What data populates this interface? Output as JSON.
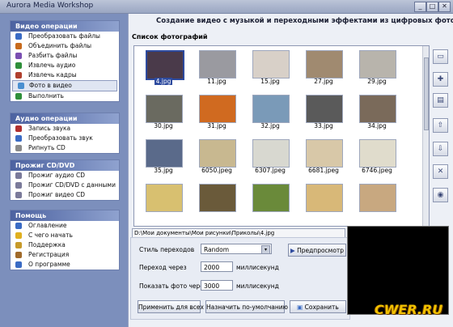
{
  "window": {
    "title": "Aurora Media Workshop",
    "controls": [
      "_",
      "□",
      "✕"
    ]
  },
  "sidebar": {
    "groups": [
      {
        "title": "Видео операции",
        "items": [
          {
            "label": "Преобразовать файлы",
            "icon": "film-icon",
            "color": "#3a6bc4"
          },
          {
            "label": "Объединить файлы",
            "icon": "link-icon",
            "color": "#c76a1c"
          },
          {
            "label": "Разбить файлы",
            "icon": "scissors-icon",
            "color": "#7a4fb2"
          },
          {
            "label": "Извлечь аудио",
            "icon": "note-icon",
            "color": "#2f8f3a"
          },
          {
            "label": "Извлечь кадры",
            "icon": "frame-icon",
            "color": "#b0402e"
          },
          {
            "label": "Фото в видео",
            "icon": "photo-icon",
            "color": "#4a8fd0",
            "selected": true
          },
          {
            "label": "Выполнить",
            "icon": "check-icon",
            "color": "#2f8f3a"
          }
        ]
      },
      {
        "title": "Аудио операции",
        "items": [
          {
            "label": "Запись звука",
            "icon": "mic-icon",
            "color": "#b03030"
          },
          {
            "label": "Преобразовать звук",
            "icon": "wave-icon",
            "color": "#3a6bc4"
          },
          {
            "label": "Рипнуть CD",
            "icon": "cd-icon",
            "color": "#8a8a8a"
          }
        ]
      },
      {
        "title": "Прожиг CD/DVD",
        "items": [
          {
            "label": "Прожиг аудио CD",
            "icon": "cd-icon",
            "color": "#7a7a9a"
          },
          {
            "label": "Прожиг CD/DVD с данными",
            "icon": "cd-icon",
            "color": "#7a7a9a"
          },
          {
            "label": "Прожиг видео CD",
            "icon": "cd-icon",
            "color": "#7a7a9a"
          }
        ]
      },
      {
        "title": "Помощь",
        "items": [
          {
            "label": "Оглавление",
            "icon": "help-icon",
            "color": "#3a6bc4"
          },
          {
            "label": "С чего начать",
            "icon": "smile-icon",
            "color": "#e0b020"
          },
          {
            "label": "Поддержка",
            "icon": "mail-icon",
            "color": "#c79a2a"
          },
          {
            "label": "Регистрация",
            "icon": "key-icon",
            "color": "#a06a2a"
          },
          {
            "label": "О программе",
            "icon": "info-icon",
            "color": "#3a6bc4"
          }
        ]
      }
    ]
  },
  "main": {
    "heading": "Создание видео с музыкой и переходными эффектами из цифровых фото",
    "list_label": "Список фотографий",
    "photos": [
      {
        "name": "4.jpg",
        "color": "#4a3a4a",
        "selected": true
      },
      {
        "name": "11.jpg",
        "color": "#9a9aa0"
      },
      {
        "name": "15.jpg",
        "color": "#d8d0c8"
      },
      {
        "name": "27.jpg",
        "color": "#a08a70"
      },
      {
        "name": "29.jpg",
        "color": "#b8b4ac"
      },
      {
        "name": "30.jpg",
        "color": "#6a6a60"
      },
      {
        "name": "31.jpg",
        "color": "#d06a20"
      },
      {
        "name": "32.jpg",
        "color": "#7a9ab8"
      },
      {
        "name": "33.jpg",
        "color": "#5a5a5a"
      },
      {
        "name": "34.jpg",
        "color": "#7a6a5a"
      },
      {
        "name": "35.jpg",
        "color": "#5a6a8a"
      },
      {
        "name": "6050.jpeg",
        "color": "#c8b890"
      },
      {
        "name": "6307.jpeg",
        "color": "#d8d8d0"
      },
      {
        "name": "6681.jpeg",
        "color": "#d8c8a8"
      },
      {
        "name": "6746.jpeg",
        "color": "#e0dccc"
      },
      {
        "name": "",
        "color": "#d8c070"
      },
      {
        "name": "",
        "color": "#6a5a3a"
      },
      {
        "name": "",
        "color": "#6a8a3a"
      },
      {
        "name": "",
        "color": "#d8b878"
      },
      {
        "name": "",
        "color": "#c8a880"
      }
    ],
    "path": "D:\\Мои документы\\Мои рисунки\\Приколы\\4.jpg",
    "transition_label": "Стиль переходов",
    "transition_value": "Random",
    "preview_button": "Предпросмотр",
    "transition_time_label": "Переход через",
    "transition_time_value": "2000",
    "show_time_label": "Показать фото через",
    "show_time_value": "3000",
    "unit": "миллисекунд",
    "apply_all_button": "Применить для всех",
    "default_button": "Назначить по-умолчанию",
    "save_button": "Сохранить",
    "toolbar": [
      {
        "name": "new-icon",
        "glyph": "▭"
      },
      {
        "name": "add-icon",
        "glyph": "✚"
      },
      {
        "name": "folder-icon",
        "glyph": "▤"
      },
      {
        "name": "up-arrow-icon",
        "glyph": "⇧"
      },
      {
        "name": "down-arrow-icon",
        "glyph": "⇩"
      },
      {
        "name": "delete-icon",
        "glyph": "✕"
      },
      {
        "name": "globe-icon",
        "glyph": "◉"
      }
    ],
    "watermark": "CWER.RU"
  }
}
